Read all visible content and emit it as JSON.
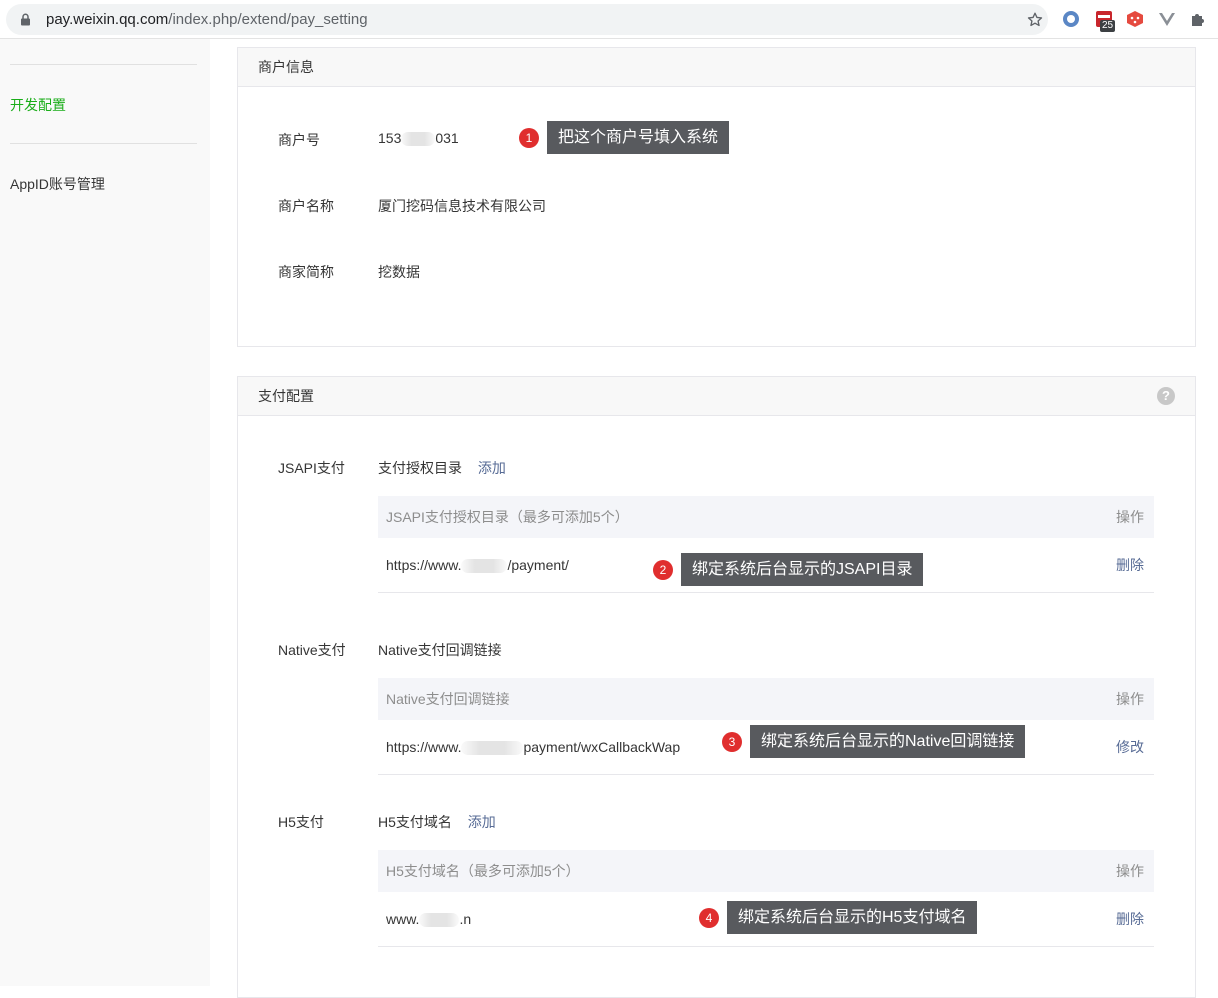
{
  "browser": {
    "url_host": "pay.weixin.qq.com",
    "url_path": "/index.php/extend/pay_setting",
    "ext_badge": "25"
  },
  "sidebar": {
    "items": [
      {
        "label": "开发配置",
        "active": true
      },
      {
        "label": "AppID账号管理",
        "active": false
      }
    ]
  },
  "merchant": {
    "title": "商户信息",
    "id_label": "商户号",
    "id_prefix": "153",
    "id_suffix": "031",
    "name_label": "商户名称",
    "name_value": "厦门挖码信息技术有限公司",
    "short_label": "商家简称",
    "short_value": "挖数据"
  },
  "pay": {
    "title": "支付配置",
    "help": "?",
    "jsapi": {
      "label": "JSAPI支付",
      "sub": "支付授权目录",
      "action": "添加",
      "col1": "JSAPI支付授权目录（最多可添加5个）",
      "col2": "操作",
      "row_prefix": "https://www.",
      "row_suffix": "/payment/",
      "row_action": "删除"
    },
    "native": {
      "label": "Native支付",
      "sub": "Native支付回调链接",
      "col1": "Native支付回调链接",
      "col2": "操作",
      "row_prefix": "https://www.",
      "row_suffix": "payment/wxCallbackWap",
      "row_action": "修改"
    },
    "h5": {
      "label": "H5支付",
      "sub": "H5支付域名",
      "action": "添加",
      "col1": "H5支付域名（最多可添加5个）",
      "col2": "操作",
      "row_prefix": "www.",
      "row_suffix": ".n",
      "row_action": "删除"
    }
  },
  "annotations": [
    {
      "num": "1",
      "text": "把这个商户号填入系统"
    },
    {
      "num": "2",
      "text": "绑定系统后台显示的JSAPI目录"
    },
    {
      "num": "3",
      "text": "绑定系统后台显示的Native回调链接"
    },
    {
      "num": "4",
      "text": "绑定系统后台显示的H5支付域名"
    }
  ]
}
